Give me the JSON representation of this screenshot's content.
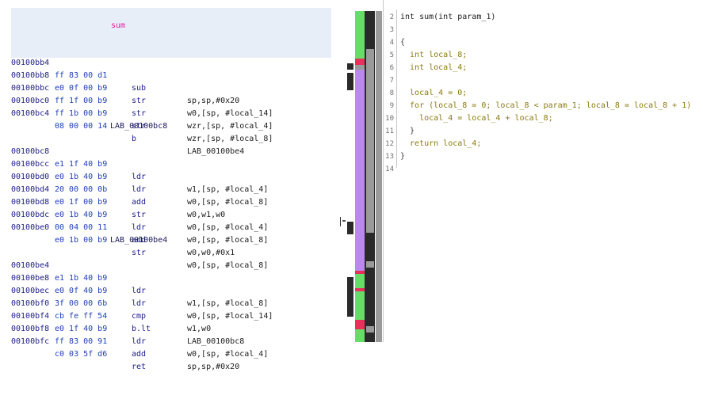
{
  "listing": {
    "function_name": "sum",
    "rows": [
      {
        "addr": "00100bb4",
        "bytes": "ff 83 00 d1",
        "mnem": "sub",
        "ops": "sp,sp,#0x20"
      },
      {
        "addr": "00100bb8",
        "bytes": "e0 0f 00 b9",
        "mnem": "str",
        "ops": "w0,[sp, #local_14]"
      },
      {
        "addr": "00100bbc",
        "bytes": "ff 1f 00 b9",
        "mnem": "str",
        "ops": "wzr,[sp, #local_4]"
      },
      {
        "addr": "00100bc0",
        "bytes": "ff 1b 00 b9",
        "mnem": "str",
        "ops": "wzr,[sp, #local_8]"
      },
      {
        "addr": "00100bc4",
        "bytes": "08 00 00 14",
        "mnem": "b",
        "ops": "LAB_00100be4"
      },
      {
        "addr": "00100bc8",
        "bytes": "e1 1f 40 b9",
        "mnem": "ldr",
        "ops": "w1,[sp, #local_4]"
      },
      {
        "addr": "00100bcc",
        "bytes": "e0 1b 40 b9",
        "mnem": "ldr",
        "ops": "w0,[sp, #local_8]"
      },
      {
        "addr": "00100bd0",
        "bytes": "20 00 00 0b",
        "mnem": "add",
        "ops": "w0,w1,w0"
      },
      {
        "addr": "00100bd4",
        "bytes": "e0 1f 00 b9",
        "mnem": "str",
        "ops": "w0,[sp, #local_4]"
      },
      {
        "addr": "00100bd8",
        "bytes": "e0 1b 40 b9",
        "mnem": "ldr",
        "ops": "w0,[sp, #local_8]"
      },
      {
        "addr": "00100bdc",
        "bytes": "00 04 00 11",
        "mnem": "add",
        "ops": "w0,w0,#0x1"
      },
      {
        "addr": "00100be0",
        "bytes": "e0 1b 00 b9",
        "mnem": "str",
        "ops": "w0,[sp, #local_8]"
      },
      {
        "addr": "00100be4",
        "bytes": "e1 1b 40 b9",
        "mnem": "ldr",
        "ops": "w1,[sp, #local_8]"
      },
      {
        "addr": "00100be8",
        "bytes": "e0 0f 40 b9",
        "mnem": "ldr",
        "ops": "w0,[sp, #local_14]"
      },
      {
        "addr": "00100bec",
        "bytes": "3f 00 00 6b",
        "mnem": "cmp",
        "ops": "w1,w0"
      },
      {
        "addr": "00100bf0",
        "bytes": "cb fe ff 54",
        "mnem": "b.lt",
        "ops": "LAB_00100bc8"
      },
      {
        "addr": "00100bf4",
        "bytes": "e0 1f 40 b9",
        "mnem": "ldr",
        "ops": "w0,[sp, #local_4]"
      },
      {
        "addr": "00100bf8",
        "bytes": "ff 83 00 91",
        "mnem": "add",
        "ops": "sp,sp,#0x20"
      },
      {
        "addr": "00100bfc",
        "bytes": "c0 03 5f d6",
        "mnem": "ret",
        "ops": ""
      }
    ],
    "labels": [
      "LAB_00100bc8",
      "LAB_00100be4"
    ]
  },
  "decompiler": {
    "lines": [
      {
        "n": "2",
        "code": "int sum(int param_1)"
      },
      {
        "n": "3",
        "code": ""
      },
      {
        "n": "4",
        "code": "{"
      },
      {
        "n": "5",
        "code": "  int local_8;"
      },
      {
        "n": "6",
        "code": "  int local_4;"
      },
      {
        "n": "7",
        "code": ""
      },
      {
        "n": "8",
        "code": "  local_4 = 0;"
      },
      {
        "n": "9",
        "code": "  for (local_8 = 0; local_8 < param_1; local_8 = local_8 + 1)"
      },
      {
        "n": "10",
        "code": "    local_4 = local_4 + local_8;"
      },
      {
        "n": "11",
        "code": "  }"
      },
      {
        "n": "12",
        "code": "  return local_4;"
      },
      {
        "n": "13",
        "code": "}"
      },
      {
        "n": "14",
        "code": ""
      }
    ]
  },
  "colors": {
    "function_name": "#e020a0",
    "address": "#20208a",
    "bytes": "#2040b8",
    "header_bg": "#e8eef8",
    "overview_green": "#66dd66",
    "overview_purple": "#bb88ee",
    "overview_red": "#e8305a",
    "overview_gray": "#9a9a9a"
  }
}
